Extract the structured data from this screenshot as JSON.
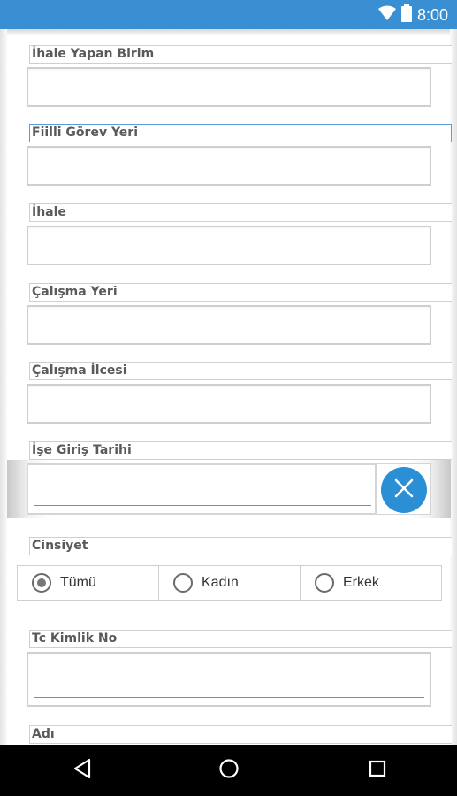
{
  "status_bar": {
    "time": "8:00",
    "icons": [
      "wifi-icon",
      "battery-icon"
    ],
    "color": "#3a8fd2"
  },
  "form": {
    "fields": [
      {
        "label": "İhale Yapan Birim",
        "value": ""
      },
      {
        "label": "Fiilli Görev Yeri",
        "value": ""
      },
      {
        "label": "İhale",
        "value": ""
      },
      {
        "label": "Çalışma Yeri",
        "value": ""
      },
      {
        "label": "Çalışma İlcesi",
        "value": ""
      }
    ],
    "date": {
      "label": "İşe Giriş Tarihi",
      "value": "",
      "clear_icon": "close-icon"
    },
    "gender": {
      "label": "Cinsiyet",
      "options": [
        "Tümü",
        "Kadın",
        "Erkek"
      ],
      "selected": "Tümü"
    },
    "tc_no": {
      "label": "Tc Kimlik No",
      "value": ""
    },
    "name": {
      "label": "Adı"
    }
  },
  "nav_bar": {
    "buttons": [
      "back-icon",
      "home-icon",
      "recents-icon"
    ]
  },
  "colors": {
    "accent": "#2b8fd6",
    "label_text": "#5a5a5a",
    "border": "#cfcfcf"
  }
}
